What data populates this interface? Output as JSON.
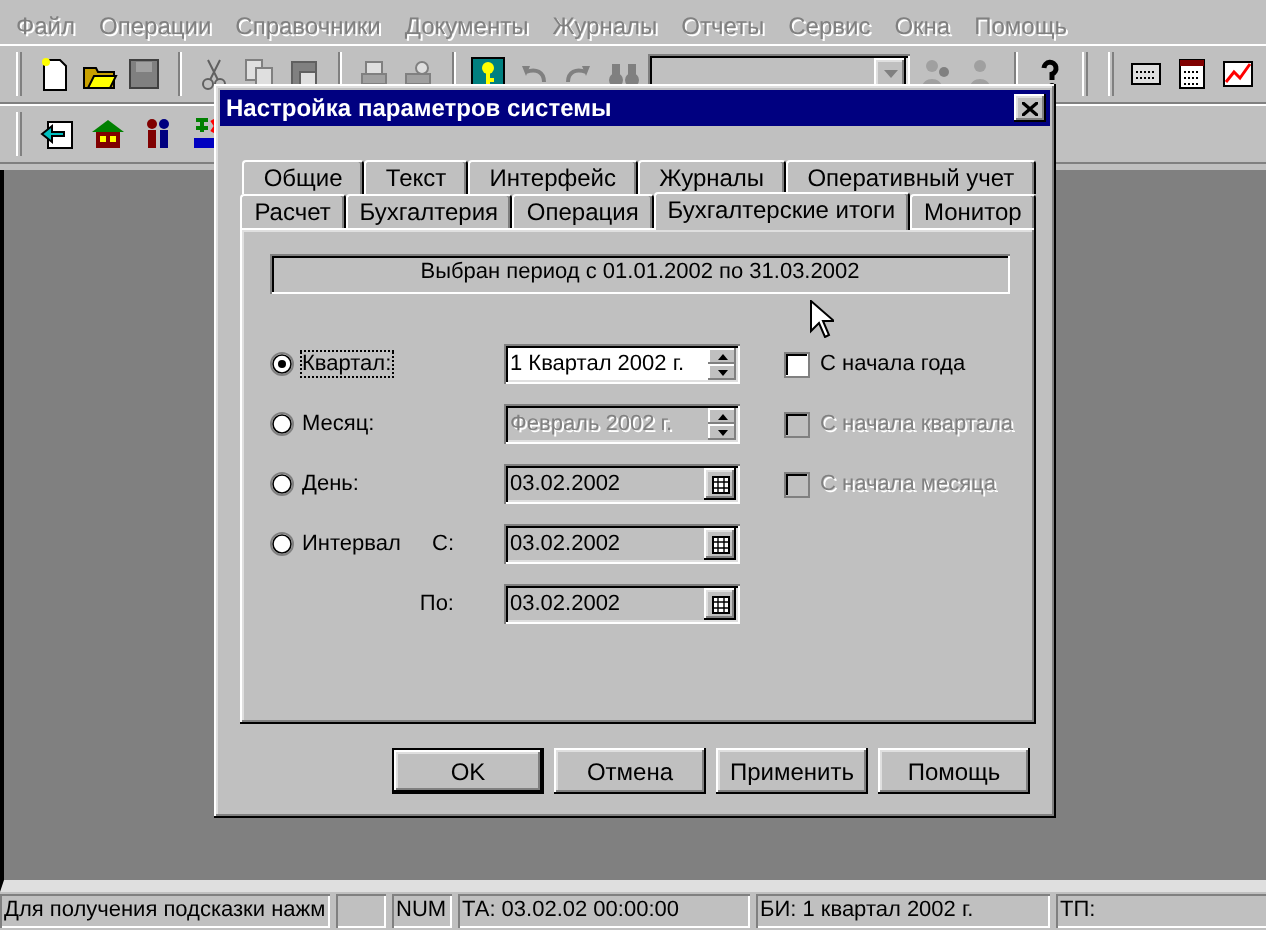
{
  "menu": [
    {
      "label": "Файл"
    },
    {
      "label": "Операции"
    },
    {
      "label": "Справочники"
    },
    {
      "label": "Документы"
    },
    {
      "label": "Журналы"
    },
    {
      "label": "Отчеты"
    },
    {
      "label": "Сервис"
    },
    {
      "label": "Окна"
    },
    {
      "label": "Помощь"
    }
  ],
  "dialog": {
    "title": "Настройка параметров системы",
    "tab_rows": [
      [
        {
          "label": "Общие",
          "selected": false
        },
        {
          "label": "Текст",
          "selected": false
        },
        {
          "label": "Интерфейс",
          "selected": false
        },
        {
          "label": "Журналы",
          "selected": false
        },
        {
          "label": "Оперативный учет",
          "selected": false
        }
      ],
      [
        {
          "label": "Расчет",
          "selected": false
        },
        {
          "label": "Бухгалтерия",
          "selected": false
        },
        {
          "label": "Операция",
          "selected": false
        },
        {
          "label": "Бухгалтерские итоги",
          "selected": true
        },
        {
          "label": "Монитор",
          "selected": false
        }
      ]
    ],
    "period": "Выбран период с 01.01.2002 по 31.03.2002",
    "options": [
      {
        "label": "Квартал:",
        "selected": true,
        "focused": true,
        "field": {
          "kind": "spin",
          "value": "1 Квартал 2002 г.",
          "disabled": false
        },
        "checkbox": {
          "label": "С начала года",
          "checked": false,
          "disabled": false
        }
      },
      {
        "label": "Месяц:",
        "selected": false,
        "focused": false,
        "field": {
          "kind": "spin",
          "value": "Февраль 2002 г.",
          "disabled": true
        },
        "checkbox": {
          "label": "С начала квартала",
          "checked": false,
          "disabled": true
        }
      },
      {
        "label": "День:",
        "selected": false,
        "focused": false,
        "field": {
          "kind": "date",
          "value": "03.02.2002",
          "disabled": false
        },
        "checkbox": {
          "label": "С начала месяца",
          "checked": false,
          "disabled": true
        }
      },
      {
        "label": "Интервал",
        "selected": false,
        "focused": false,
        "sublabel": "С:",
        "field": {
          "kind": "date",
          "value": "03.02.2002",
          "disabled": false
        }
      }
    ],
    "interval_to": {
      "label": "По:",
      "field": {
        "kind": "date",
        "value": "03.02.2002",
        "disabled": false
      }
    },
    "buttons": [
      {
        "label": "OK",
        "default": true
      },
      {
        "label": "Отмена",
        "default": false
      },
      {
        "label": "Применить",
        "default": false
      },
      {
        "label": "Помощь",
        "default": false
      }
    ]
  },
  "status_bar": [
    {
      "text": "Для получения подсказки нажм"
    },
    {
      "text": "NUM"
    },
    {
      "text": "ТА: 03.02.02  00:00:00"
    },
    {
      "text": "БИ: 1 квартал 2002 г."
    },
    {
      "text": "ТП:"
    }
  ]
}
